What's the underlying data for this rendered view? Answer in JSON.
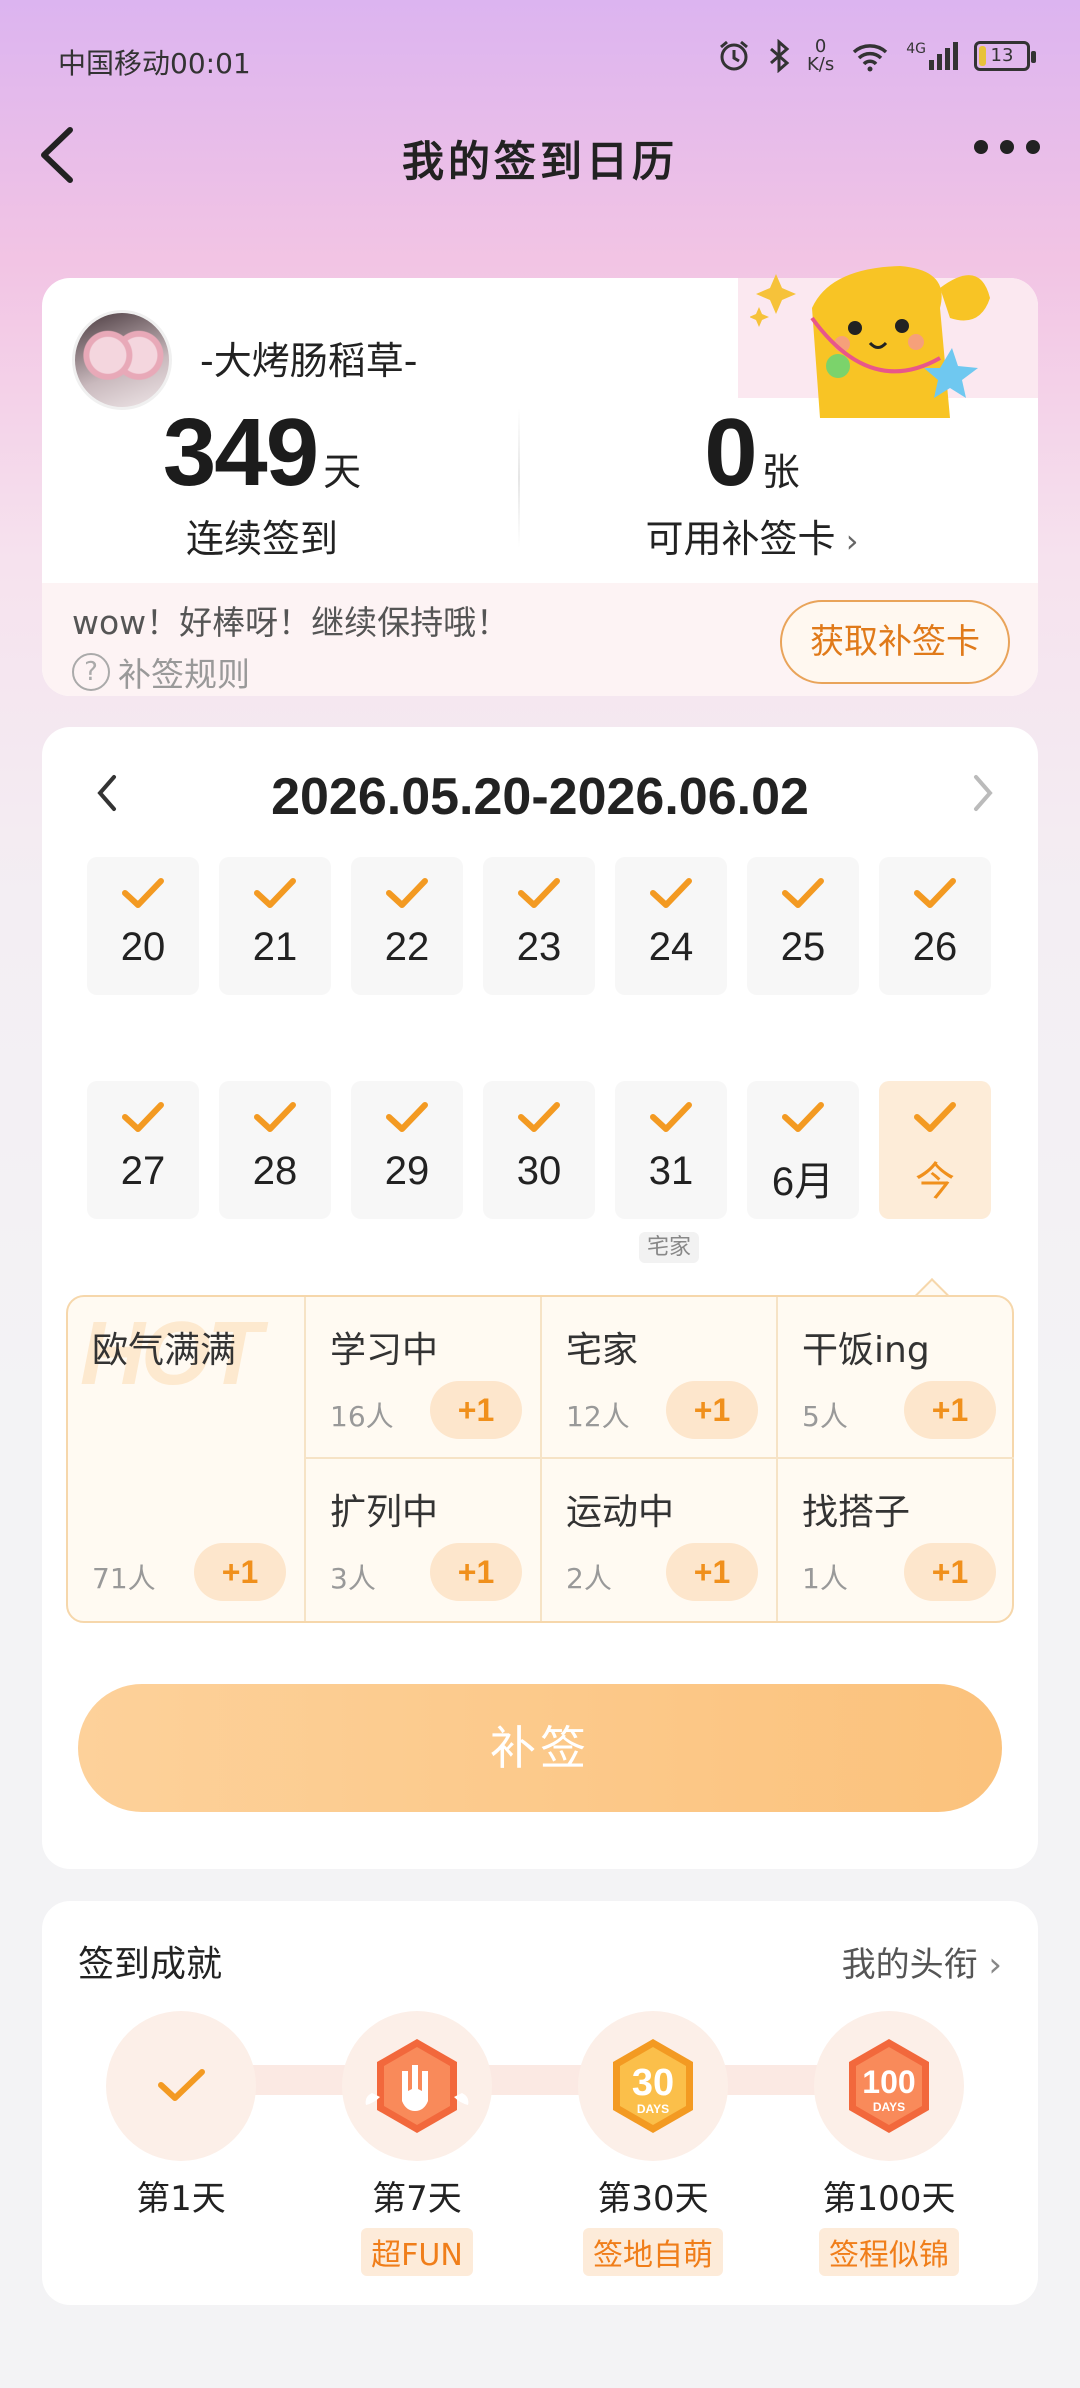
{
  "status_bar": {
    "carrier_time": "中国移动00:01",
    "net_speed_value": "0",
    "net_speed_unit": "K/s",
    "network": "4G",
    "battery": "13"
  },
  "header": {
    "title": "我的签到日历"
  },
  "profile": {
    "username": "-大烤肠稻草-",
    "streak_value": "349",
    "streak_unit": "天",
    "streak_label": "连续签到",
    "cards_value": "0",
    "cards_unit": "张",
    "cards_label": "可用补签卡",
    "message": "wow！好棒呀！继续保持哦！",
    "rule_label": "补签规则",
    "get_card_label": "获取补签卡"
  },
  "calendar": {
    "range": "2026.05.20-2026.06.02",
    "row1": [
      "20",
      "21",
      "22",
      "23",
      "24",
      "25",
      "26"
    ],
    "row2": [
      "27",
      "28",
      "29",
      "30",
      "31",
      "6月",
      "今"
    ],
    "tag_under_31": "宅家"
  },
  "moods": {
    "plus_label": "+1",
    "items": [
      {
        "name": "欧气满满",
        "count": "71人"
      },
      {
        "name": "学习中",
        "count": "16人"
      },
      {
        "name": "宅家",
        "count": "12人"
      },
      {
        "name": "干饭ing",
        "count": "5人"
      },
      {
        "name": "扩列中",
        "count": "3人"
      },
      {
        "name": "运动中",
        "count": "2人"
      },
      {
        "name": "找搭子",
        "count": "1人"
      }
    ],
    "watermark": "HOT"
  },
  "makeup_button": "补签",
  "achievements": {
    "title": "签到成就",
    "link": "我的头衔",
    "items": [
      {
        "day": "第1天",
        "tag": ""
      },
      {
        "day": "第7天",
        "tag": "超FUN"
      },
      {
        "day": "第30天",
        "tag": "签地自萌"
      },
      {
        "day": "第100天",
        "tag": "签程似锦"
      }
    ],
    "badge_30_text": "30",
    "badge_100_text": "100",
    "badge_days_text": "DAYS"
  },
  "colors": {
    "accent": "#f0901c",
    "check": "#f39a22"
  }
}
